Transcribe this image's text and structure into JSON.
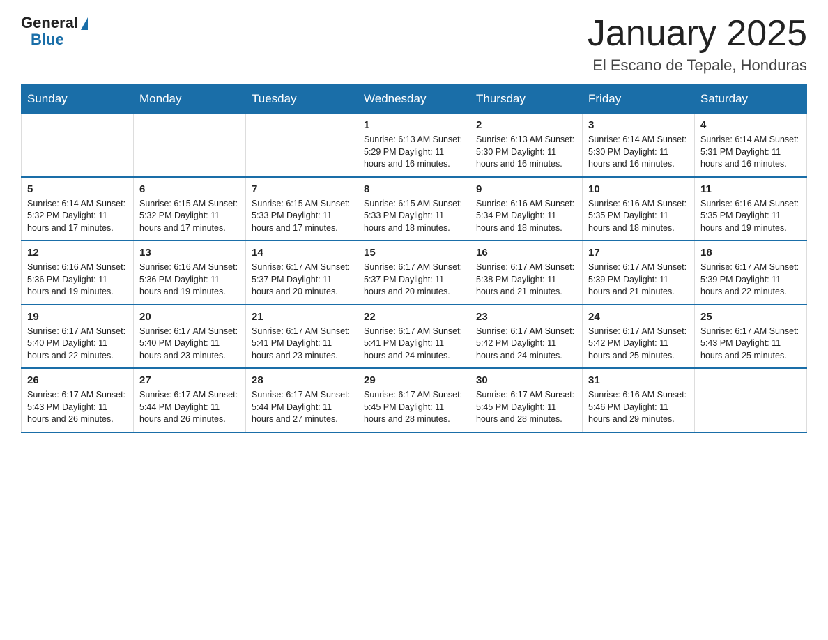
{
  "logo": {
    "general": "General",
    "blue": "Blue"
  },
  "title": "January 2025",
  "subtitle": "El Escano de Tepale, Honduras",
  "days_header": [
    "Sunday",
    "Monday",
    "Tuesday",
    "Wednesday",
    "Thursday",
    "Friday",
    "Saturday"
  ],
  "weeks": [
    [
      {
        "num": "",
        "info": ""
      },
      {
        "num": "",
        "info": ""
      },
      {
        "num": "",
        "info": ""
      },
      {
        "num": "1",
        "info": "Sunrise: 6:13 AM\nSunset: 5:29 PM\nDaylight: 11 hours and 16 minutes."
      },
      {
        "num": "2",
        "info": "Sunrise: 6:13 AM\nSunset: 5:30 PM\nDaylight: 11 hours and 16 minutes."
      },
      {
        "num": "3",
        "info": "Sunrise: 6:14 AM\nSunset: 5:30 PM\nDaylight: 11 hours and 16 minutes."
      },
      {
        "num": "4",
        "info": "Sunrise: 6:14 AM\nSunset: 5:31 PM\nDaylight: 11 hours and 16 minutes."
      }
    ],
    [
      {
        "num": "5",
        "info": "Sunrise: 6:14 AM\nSunset: 5:32 PM\nDaylight: 11 hours and 17 minutes."
      },
      {
        "num": "6",
        "info": "Sunrise: 6:15 AM\nSunset: 5:32 PM\nDaylight: 11 hours and 17 minutes."
      },
      {
        "num": "7",
        "info": "Sunrise: 6:15 AM\nSunset: 5:33 PM\nDaylight: 11 hours and 17 minutes."
      },
      {
        "num": "8",
        "info": "Sunrise: 6:15 AM\nSunset: 5:33 PM\nDaylight: 11 hours and 18 minutes."
      },
      {
        "num": "9",
        "info": "Sunrise: 6:16 AM\nSunset: 5:34 PM\nDaylight: 11 hours and 18 minutes."
      },
      {
        "num": "10",
        "info": "Sunrise: 6:16 AM\nSunset: 5:35 PM\nDaylight: 11 hours and 18 minutes."
      },
      {
        "num": "11",
        "info": "Sunrise: 6:16 AM\nSunset: 5:35 PM\nDaylight: 11 hours and 19 minutes."
      }
    ],
    [
      {
        "num": "12",
        "info": "Sunrise: 6:16 AM\nSunset: 5:36 PM\nDaylight: 11 hours and 19 minutes."
      },
      {
        "num": "13",
        "info": "Sunrise: 6:16 AM\nSunset: 5:36 PM\nDaylight: 11 hours and 19 minutes."
      },
      {
        "num": "14",
        "info": "Sunrise: 6:17 AM\nSunset: 5:37 PM\nDaylight: 11 hours and 20 minutes."
      },
      {
        "num": "15",
        "info": "Sunrise: 6:17 AM\nSunset: 5:37 PM\nDaylight: 11 hours and 20 minutes."
      },
      {
        "num": "16",
        "info": "Sunrise: 6:17 AM\nSunset: 5:38 PM\nDaylight: 11 hours and 21 minutes."
      },
      {
        "num": "17",
        "info": "Sunrise: 6:17 AM\nSunset: 5:39 PM\nDaylight: 11 hours and 21 minutes."
      },
      {
        "num": "18",
        "info": "Sunrise: 6:17 AM\nSunset: 5:39 PM\nDaylight: 11 hours and 22 minutes."
      }
    ],
    [
      {
        "num": "19",
        "info": "Sunrise: 6:17 AM\nSunset: 5:40 PM\nDaylight: 11 hours and 22 minutes."
      },
      {
        "num": "20",
        "info": "Sunrise: 6:17 AM\nSunset: 5:40 PM\nDaylight: 11 hours and 23 minutes."
      },
      {
        "num": "21",
        "info": "Sunrise: 6:17 AM\nSunset: 5:41 PM\nDaylight: 11 hours and 23 minutes."
      },
      {
        "num": "22",
        "info": "Sunrise: 6:17 AM\nSunset: 5:41 PM\nDaylight: 11 hours and 24 minutes."
      },
      {
        "num": "23",
        "info": "Sunrise: 6:17 AM\nSunset: 5:42 PM\nDaylight: 11 hours and 24 minutes."
      },
      {
        "num": "24",
        "info": "Sunrise: 6:17 AM\nSunset: 5:42 PM\nDaylight: 11 hours and 25 minutes."
      },
      {
        "num": "25",
        "info": "Sunrise: 6:17 AM\nSunset: 5:43 PM\nDaylight: 11 hours and 25 minutes."
      }
    ],
    [
      {
        "num": "26",
        "info": "Sunrise: 6:17 AM\nSunset: 5:43 PM\nDaylight: 11 hours and 26 minutes."
      },
      {
        "num": "27",
        "info": "Sunrise: 6:17 AM\nSunset: 5:44 PM\nDaylight: 11 hours and 26 minutes."
      },
      {
        "num": "28",
        "info": "Sunrise: 6:17 AM\nSunset: 5:44 PM\nDaylight: 11 hours and 27 minutes."
      },
      {
        "num": "29",
        "info": "Sunrise: 6:17 AM\nSunset: 5:45 PM\nDaylight: 11 hours and 28 minutes."
      },
      {
        "num": "30",
        "info": "Sunrise: 6:17 AM\nSunset: 5:45 PM\nDaylight: 11 hours and 28 minutes."
      },
      {
        "num": "31",
        "info": "Sunrise: 6:16 AM\nSunset: 5:46 PM\nDaylight: 11 hours and 29 minutes."
      },
      {
        "num": "",
        "info": ""
      }
    ]
  ]
}
